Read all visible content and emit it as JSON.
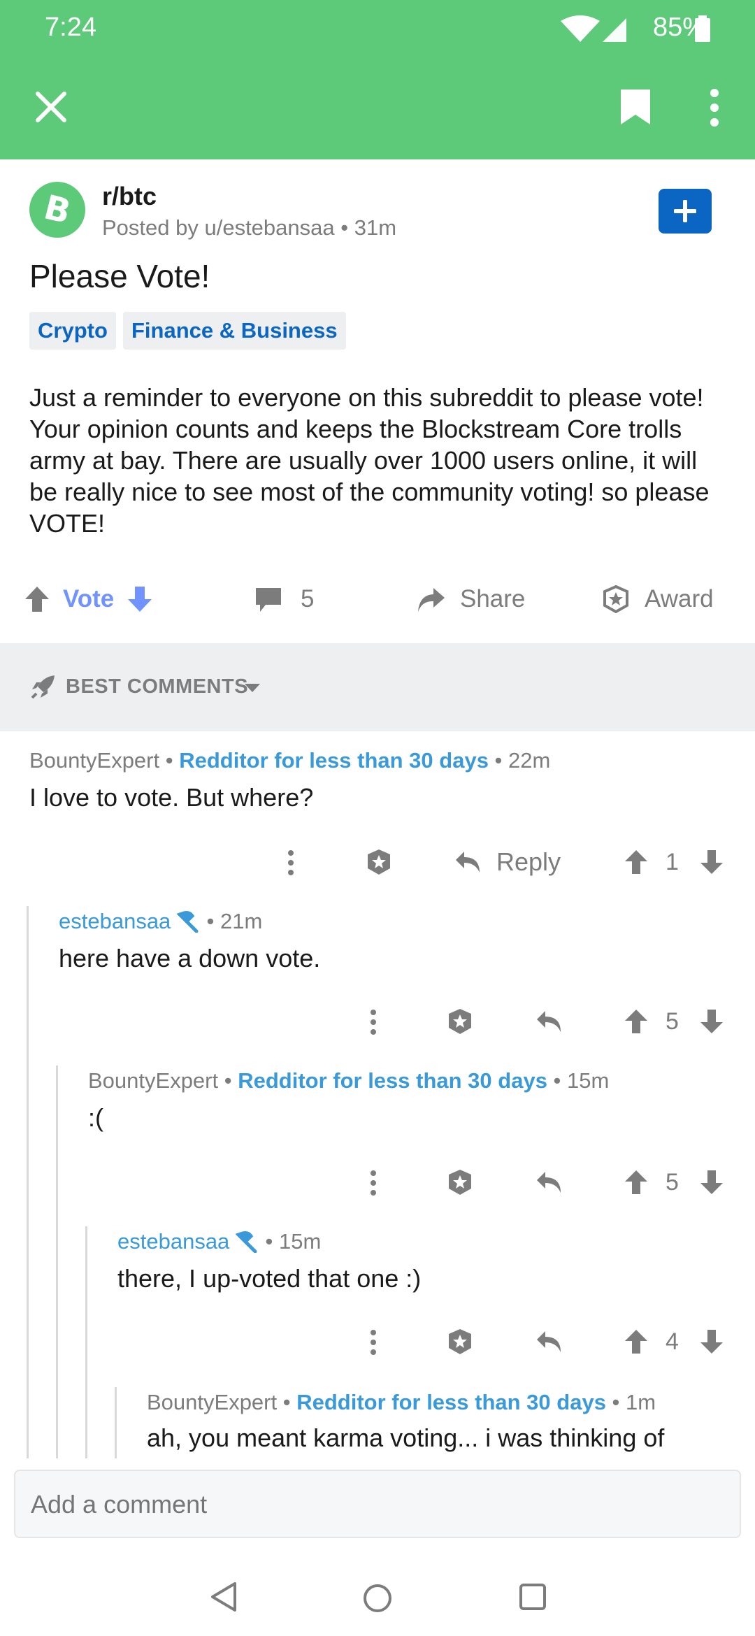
{
  "status_bar": {
    "time": "7:24",
    "battery": "85%"
  },
  "post": {
    "subreddit": "r/btc",
    "posted_by": "Posted by u/estebansaa",
    "age": "31m",
    "title": "Please Vote!",
    "flairs": [
      "Crypto",
      "Finance & Business"
    ],
    "body": "Just a reminder to everyone on this subreddit to please vote! Your opinion counts and keeps the Blockstream Core trolls army at bay. There are usually over 1000 users online, it will be really nice to see most of the community voting! so please VOTE!",
    "vote_label": "Vote",
    "comment_count": "5",
    "share_label": "Share",
    "award_label": "Award"
  },
  "sort": {
    "label": "BEST COMMENTS"
  },
  "comments": [
    {
      "author": "BountyExpert",
      "flair": "Redditor for less than 30 days",
      "age": "22m",
      "text": "I love to vote. But where?",
      "reply_label": "Reply",
      "score": "1"
    },
    {
      "author": "estebansaa",
      "age": "21m",
      "text": "here have a down vote.",
      "score": "5"
    },
    {
      "author": "BountyExpert",
      "flair": "Redditor for less than 30 days",
      "age": "15m",
      "text": ":(",
      "score": "5"
    },
    {
      "author": "estebansaa",
      "age": "15m",
      "text": "there, I up-voted that one :)",
      "score": "4"
    },
    {
      "author": "BountyExpert",
      "flair": "Redditor for less than 30 days",
      "age": "1m",
      "text": "ah, you meant karma voting... i was thinking of"
    }
  ],
  "comment_input": {
    "placeholder": "Add a comment"
  },
  "colors": {
    "brand": "#5dca79",
    "link": "#3a9ad9",
    "upvote_blue": "#7193ff",
    "join_blue": "#0a66c2"
  },
  "icons": [
    "close-icon",
    "bookmark-icon",
    "more-vert-icon",
    "bitcoin-cash-icon",
    "plus-icon",
    "upvote-icon",
    "downvote-icon",
    "comment-icon",
    "share-icon",
    "award-icon",
    "rocket-icon",
    "chevron-down-icon",
    "reply-icon",
    "wrench-icon",
    "back-nav-icon",
    "home-nav-icon",
    "recents-nav-icon"
  ]
}
